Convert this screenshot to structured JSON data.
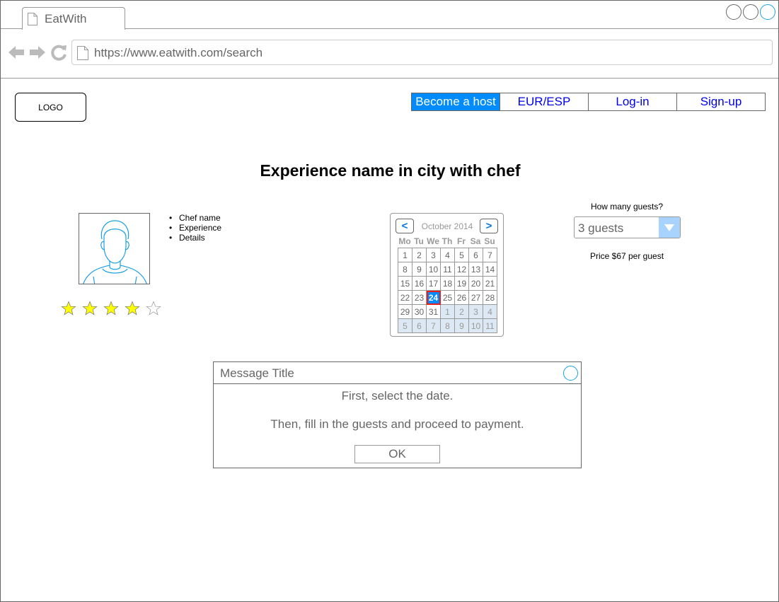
{
  "browser": {
    "tab_title": "EatWith",
    "url": "https://www.eatwith.com/search"
  },
  "header": {
    "logo": "LOGO",
    "nav": [
      {
        "label": "Become a host",
        "active": true
      },
      {
        "label": "EUR/ESP",
        "active": false
      },
      {
        "label": "Log-in",
        "active": false
      },
      {
        "label": "Sign-up",
        "active": false
      }
    ]
  },
  "main": {
    "title": "Experience name in city with chef",
    "chef_details": [
      "Chef name",
      "Experience",
      "Details"
    ],
    "rating": {
      "value": 4,
      "max": 5
    }
  },
  "calendar": {
    "month": "October 2014",
    "prev_label": "<",
    "next_label": ">",
    "weekdays": [
      "Mo",
      "Tu",
      "We",
      "Th",
      "Fr",
      "Sa",
      "Su"
    ],
    "days": [
      [
        "1",
        "2",
        "3",
        "4",
        "5",
        "6",
        "7"
      ],
      [
        "8",
        "9",
        "10",
        "11",
        "12",
        "13",
        "14"
      ],
      [
        "15",
        "16",
        "17",
        "18",
        "19",
        "20",
        "21"
      ],
      [
        "22",
        "23",
        "24",
        "25",
        "26",
        "27",
        "28"
      ],
      [
        "29",
        "30",
        "31",
        "1",
        "2",
        "3",
        "4"
      ],
      [
        "5",
        "6",
        "7",
        "8",
        "9",
        "10",
        "11"
      ]
    ],
    "selected": "24",
    "current_month_days": 31
  },
  "booking": {
    "guests_question": "How many guests?",
    "guests_value": "3 guests",
    "price": "Price $67 per guest"
  },
  "dialog": {
    "title": "Message Title",
    "line1": "First, select the date.",
    "line2": "Then, fill in the guests and proceed to payment.",
    "ok": "OK"
  },
  "colors": {
    "accent": "#008cff",
    "link": "#0000ee",
    "star": "#ffff00",
    "calendar_other": "#dce9f5",
    "selected_outline": "#e51e1e"
  }
}
